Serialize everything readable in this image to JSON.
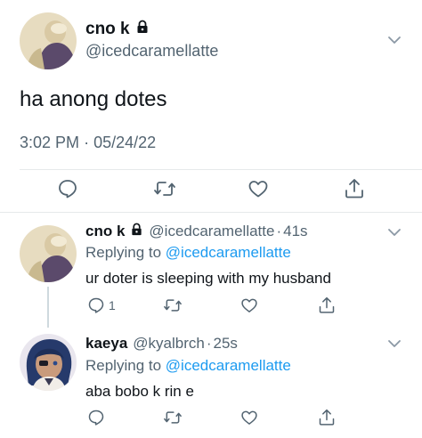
{
  "main_tweet": {
    "name": "cno k",
    "handle": "@icedcaramellatte",
    "text": "ha anong dotes",
    "time": "3:02 PM",
    "separator": "·",
    "date": "05/24/22"
  },
  "replies": [
    {
      "name": "cno k",
      "handle": "@icedcaramellatte",
      "separator": "·",
      "time": "41s",
      "replying_prefix": "Replying to",
      "replying_handle": "@icedcaramellatte",
      "text": "ur doter is sleeping with my husband",
      "reply_count": "1"
    },
    {
      "name": "kaeya",
      "handle": "@kyalbrch",
      "separator": "·",
      "time": "25s",
      "replying_prefix": "Replying to",
      "replying_handle": "@icedcaramellatte",
      "text": "aba bobo k rin e"
    }
  ],
  "icons": [
    "lock-icon",
    "chevron-down-icon",
    "reply-icon",
    "retweet-icon",
    "like-icon",
    "share-icon"
  ],
  "colors": {
    "text": "#0f1419",
    "secondary": "#536471",
    "link": "#1d9bf0",
    "divider": "#e6e9eb"
  }
}
